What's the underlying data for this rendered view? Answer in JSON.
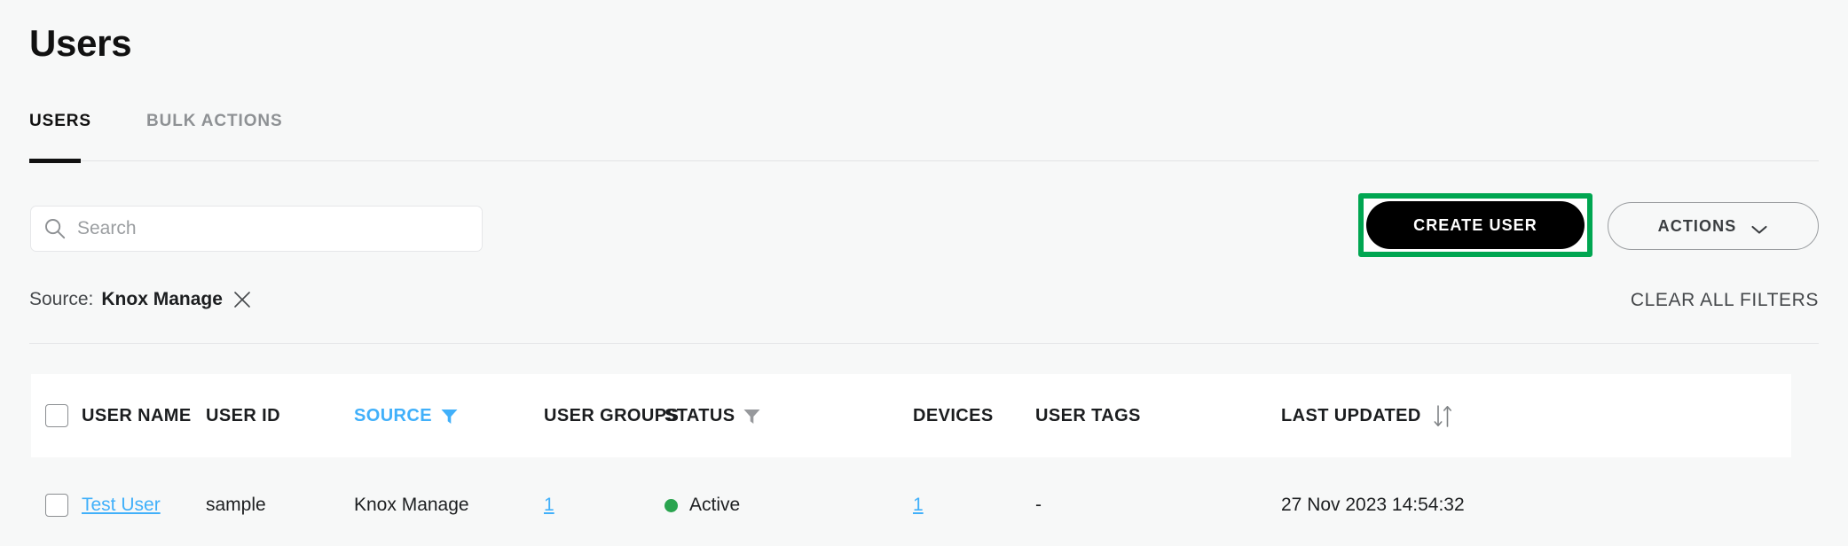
{
  "page": {
    "title": "Users"
  },
  "tabs": [
    {
      "label": "USERS",
      "active": true
    },
    {
      "label": "BULK ACTIONS",
      "active": false
    }
  ],
  "toolbar": {
    "search": {
      "placeholder": "Search",
      "value": "",
      "icon": "search-icon"
    },
    "create_user_label": "CREATE USER",
    "actions_label": "ACTIONS",
    "actions_icon": "chevron-down-icon",
    "highlight_color": "#00a651"
  },
  "filters": {
    "chip_label": "Source:",
    "chip_value": "Knox Manage",
    "remove_icon": "close-icon",
    "clear_all_label": "CLEAR ALL FILTERS"
  },
  "table": {
    "headers": {
      "select_all": "select-all-checkbox",
      "user_name": "USER NAME",
      "user_id": "USER ID",
      "source": "SOURCE",
      "user_groups": "USER GROUPS",
      "status": "STATUS",
      "devices": "DEVICES",
      "user_tags": "USER TAGS",
      "last_updated": "LAST UPDATED"
    },
    "header_states": {
      "source_filtered": true,
      "source_color": "#41b0fa",
      "status_filter_color": "#8e9194",
      "sort_icon": "sort-arrows-icon",
      "filter_icon": "funnel-icon"
    },
    "rows": [
      {
        "user_name": "Test User",
        "user_id": "sample",
        "source": "Knox Manage",
        "user_groups": "1",
        "status": "Active",
        "status_color": "#2aa44f",
        "devices": "1",
        "user_tags": "-",
        "last_updated": "27 Nov 2023 14:54:32"
      }
    ]
  }
}
